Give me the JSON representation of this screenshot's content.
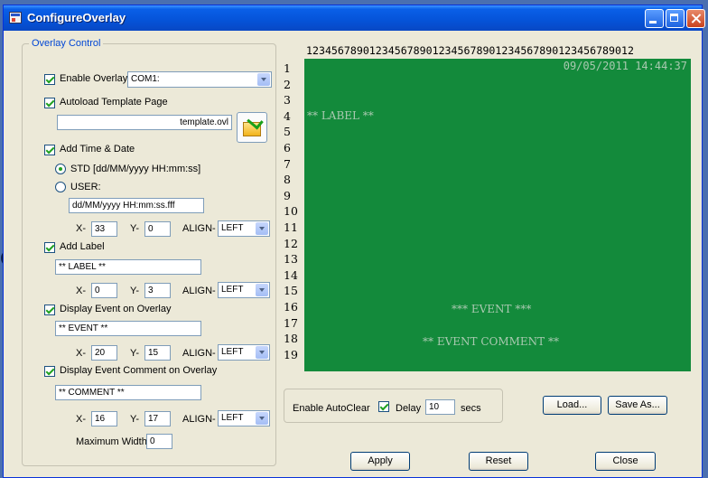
{
  "window": {
    "title": "ConfigureOverlay"
  },
  "background_fragment": "e",
  "overlay_control": {
    "group_title": "Overlay Control",
    "enable_overlay": {
      "label": "Enable Overlay",
      "checked": true,
      "port": "COM1:"
    },
    "autoload": {
      "label": "Autoload Template Page",
      "checked": true,
      "file": "template.ovl"
    },
    "time_date": {
      "label": "Add Time & Date",
      "checked": true,
      "std_label": "STD [dd/MM/yyyy HH:mm:ss]",
      "user_label": "USER:",
      "user_format": "dd/MM/yyyy HH:mm:ss.fff",
      "x": "33",
      "y": "0",
      "align": "LEFT"
    },
    "label": {
      "label": "Add Label",
      "checked": true,
      "text": "** LABEL **",
      "x": "0",
      "y": "3",
      "align": "LEFT"
    },
    "event": {
      "label": "Display Event on Overlay",
      "checked": true,
      "text": "** EVENT **",
      "x": "20",
      "y": "15",
      "align": "LEFT"
    },
    "comment": {
      "label": "Display Event Comment on Overlay",
      "checked": true,
      "text": "** COMMENT **",
      "x": "16",
      "y": "17",
      "align": "LEFT"
    },
    "x_prefix": "X-",
    "y_prefix": "Y-",
    "align_prefix": "ALIGN-",
    "max_width_label": "Maximum Width-",
    "max_width": "0"
  },
  "preview": {
    "column_ruler": "1234567890123456789012345678901234567890123456789012",
    "line_numbers": [
      "1",
      "2",
      "3",
      "4",
      "5",
      "6",
      "7",
      "8",
      "9",
      "10",
      "11",
      "12",
      "13",
      "14",
      "15",
      "16",
      "17",
      "18",
      "19"
    ],
    "datetime": "09/05/2011 14:44:37",
    "label": "** LABEL **",
    "event": "*** EVENT ***",
    "comment": "** EVENT  COMMENT **",
    "screen_color": "#138a3b"
  },
  "autoclear": {
    "label": "Enable AutoClear",
    "checked": true,
    "delay_label": "Delay",
    "delay": "10",
    "unit": "secs"
  },
  "buttons": {
    "load": "Load...",
    "save_as": "Save As...",
    "apply": "Apply",
    "reset": "Reset",
    "close": "Close"
  }
}
